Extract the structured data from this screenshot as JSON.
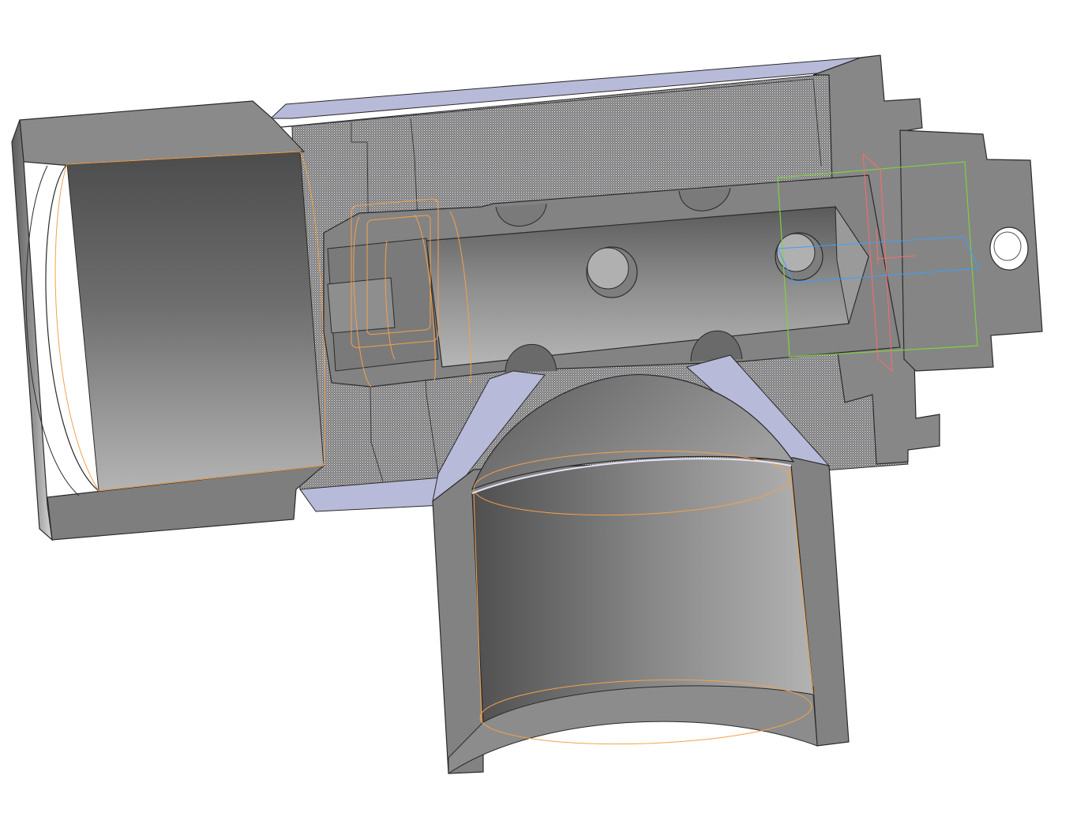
{
  "viewport": {
    "background_color": "#ffffff"
  },
  "model": {
    "body_color": "#8a8a8a",
    "section_hatch_color": "#7c7c7c",
    "cut_face_color": "#7a7a7a",
    "transparent_cap_color": "#b8bad9",
    "highlight_edge_color": "#f5a14a",
    "outline_color": "#2a2a2a",
    "bore_dark_color": "#4c4c4c",
    "bore_light_color": "#b4b4b4"
  },
  "section_plane": {
    "frame_color": "#80d040",
    "axis_x_color": "#3aa0ff",
    "axis_y_color": "#ff6b6b"
  }
}
